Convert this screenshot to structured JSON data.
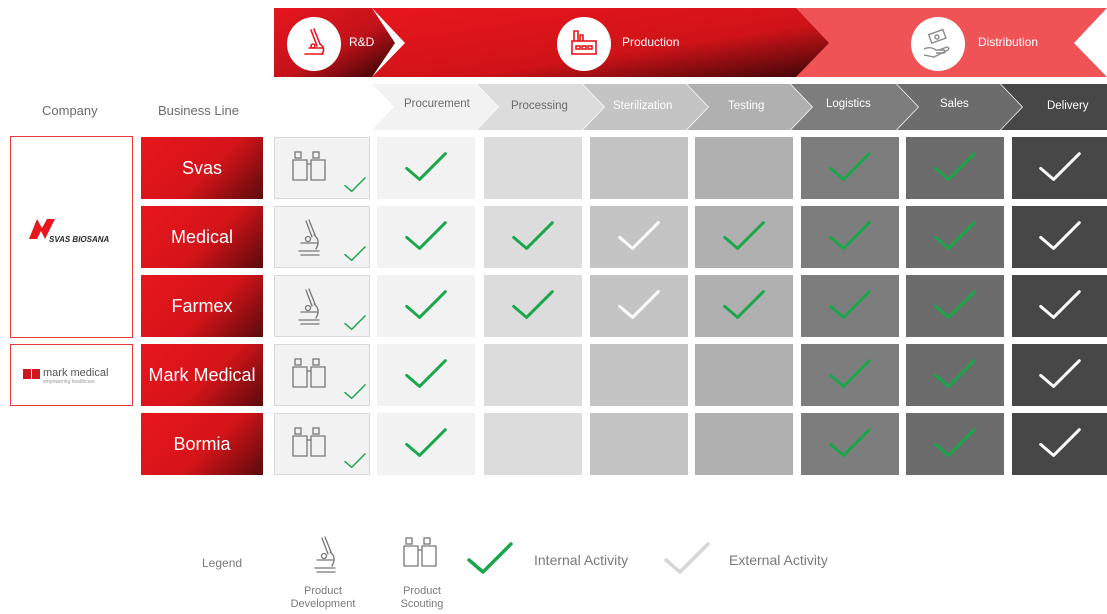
{
  "stages": [
    {
      "label": "R&D",
      "icon": "microscope-icon"
    },
    {
      "label": "Production",
      "icon": "factory-icon"
    },
    {
      "label": "Distribution",
      "icon": "money-hand-icon"
    }
  ],
  "header": {
    "company_label": "Company",
    "business_line_label": "Business Line"
  },
  "steps": [
    "Procurement",
    "Processing",
    "Sterilization",
    "Testing",
    "Logistics",
    "Sales",
    "Delivery"
  ],
  "companies": [
    {
      "name": "SVAS BIOSANA",
      "logo": "svas-biosana-logo"
    },
    {
      "name": "mark medical",
      "tagline": "empowering healthcare",
      "logo": "mark-medical-logo"
    }
  ],
  "business_lines": [
    {
      "name": "Svas",
      "rd": "binoculars",
      "checks": [
        "internal",
        "",
        "",
        "",
        "internal",
        "internal",
        "external"
      ]
    },
    {
      "name": "Medical",
      "rd": "microscope",
      "checks": [
        "internal",
        "internal",
        "external",
        "internal",
        "internal",
        "internal",
        "external"
      ]
    },
    {
      "name": "Farmex",
      "rd": "microscope",
      "checks": [
        "internal",
        "internal",
        "external",
        "internal",
        "internal",
        "internal",
        "external"
      ]
    },
    {
      "name": "Mark Medical",
      "rd": "binoculars",
      "checks": [
        "internal",
        "",
        "",
        "",
        "internal",
        "internal",
        "external"
      ]
    },
    {
      "name": "Bormia",
      "rd": "binoculars",
      "checks": [
        "internal",
        "",
        "",
        "",
        "internal",
        "internal",
        "external"
      ]
    }
  ],
  "legend": {
    "title": "Legend",
    "product_development": "Product Development",
    "product_scouting": "Product Scouting",
    "internal": "Internal Activity",
    "external": "External Activity"
  },
  "colors": {
    "red": "#e8161d",
    "dark_red": "#5a0a0c",
    "salmon": "#ef5356",
    "check_internal": "#1aa64b",
    "check_external": "#ffffff",
    "col_bg": [
      "#f2f2f2",
      "#dcdcdc",
      "#c4c4c4",
      "#b0b0b0",
      "#7d7d7d",
      "#6c6c6c",
      "#474747"
    ]
  }
}
